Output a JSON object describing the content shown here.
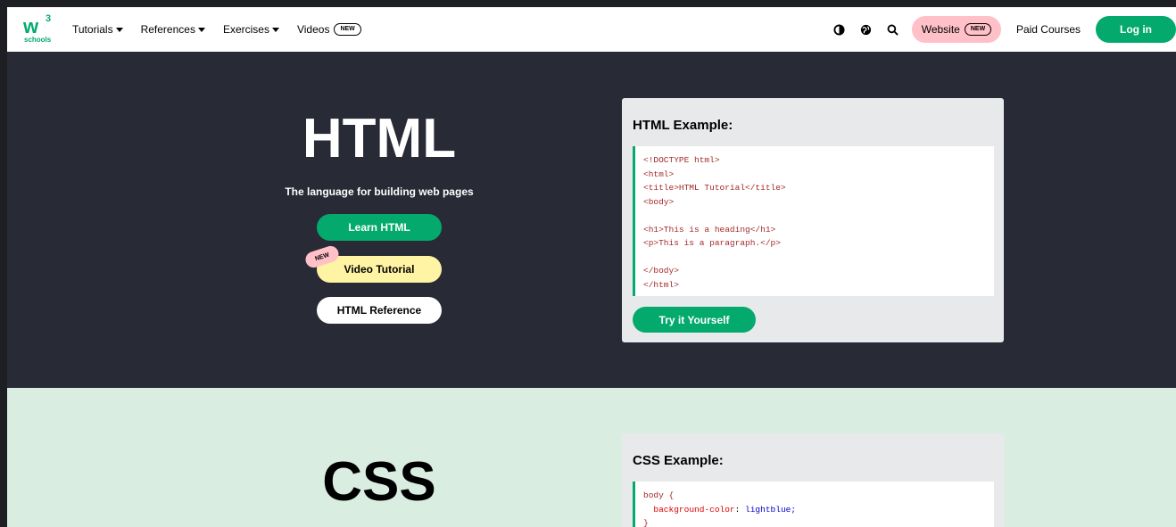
{
  "nav": {
    "logo_text": "w",
    "logo_sup": "3",
    "logo_sub": "schools",
    "links": [
      {
        "label": "Tutorials"
      },
      {
        "label": "References"
      },
      {
        "label": "Exercises"
      },
      {
        "label": "Videos",
        "badge": "NEW"
      }
    ],
    "website_label": "Website",
    "website_badge": "NEW",
    "paid_courses": "Paid Courses",
    "login": "Log in",
    "icons": [
      "contrast-icon",
      "globe-icon",
      "search-icon"
    ]
  },
  "html_section": {
    "title": "HTML",
    "tagline": "The language for building web pages",
    "learn_button": "Learn HTML",
    "video_button": "Video Tutorial",
    "new_tag": "NEW",
    "reference_button": "HTML Reference",
    "example_title": "HTML Example:",
    "code": [
      "<!DOCTYPE html>",
      "<html>",
      "<title>HTML Tutorial</title>",
      "<body>",
      "",
      "<h1>This is a heading</h1>",
      "<p>This is a paragraph.</p>",
      "",
      "</body>",
      "</html>"
    ],
    "try_button": "Try it Yourself"
  },
  "css_section": {
    "title": "CSS",
    "example_title": "CSS Example:",
    "code_selector": "body {",
    "code_property": "background-color",
    "code_value": "lightblue;",
    "code_close": "}"
  },
  "colors": {
    "brand_green": "#04aa6d",
    "dark_bg": "#282a35",
    "pink": "#ffc0c7",
    "yellow": "#fff4a3",
    "mint": "#d9eee1"
  }
}
